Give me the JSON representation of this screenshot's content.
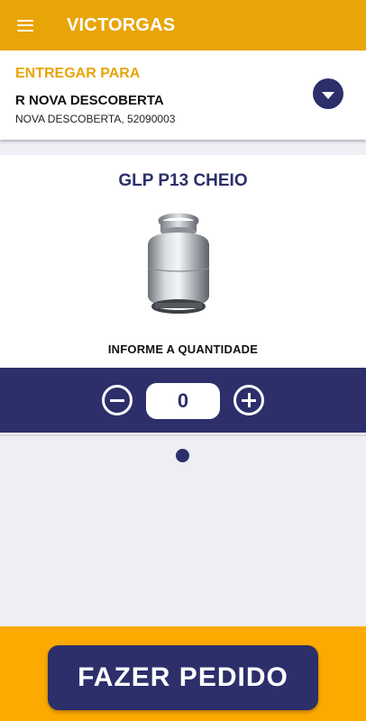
{
  "app": {
    "title": "VICTORGAS",
    "brand_color": "#e8a507",
    "accent_color": "#2c2f6a",
    "menu_icon": "hamburger-menu-icon"
  },
  "address": {
    "label": "ENTREGAR PARA",
    "street": "R NOVA DESCOBERTA",
    "detail": "NOVA DESCOBERTA, 52090003",
    "toggle_icon": "chevron-down-icon"
  },
  "product": {
    "name": "GLP P13 CHEIO",
    "image": "gas-cylinder-image",
    "quantity_label": "INFORME A QUANTIDADE"
  },
  "quantity": {
    "value": "0",
    "decrement_icon": "minus-circle-icon",
    "increment_icon": "plus-circle-icon"
  },
  "pagination": {
    "pages": 1,
    "current": 1
  },
  "footer": {
    "order_button_label": "FAZER PEDIDO",
    "background_color": "#fdaa00"
  }
}
